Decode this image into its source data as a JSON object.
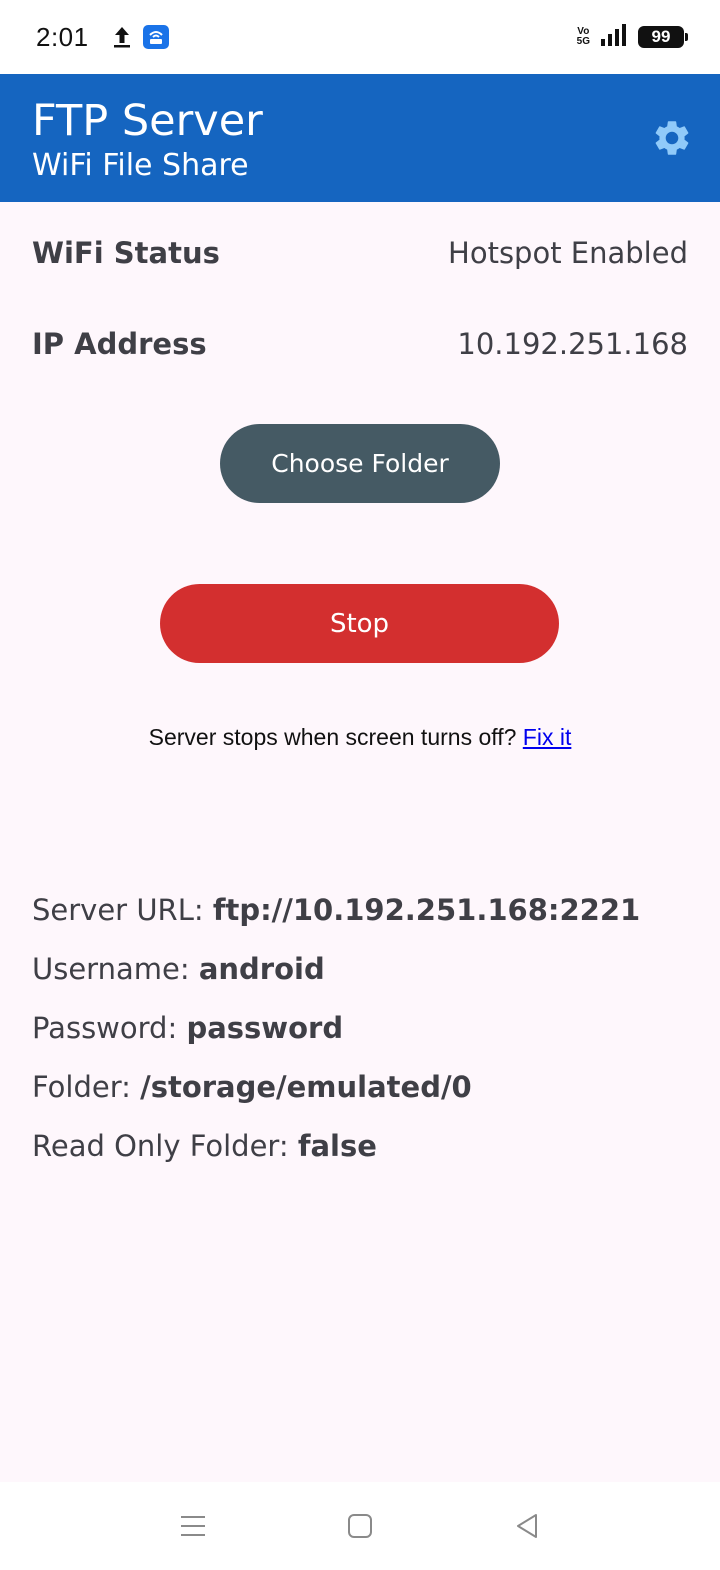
{
  "status_bar": {
    "time": "2:01",
    "battery": "99",
    "volte_top": "Vo",
    "volte_bottom": "5G",
    "icons": [
      "upload-icon",
      "app-notification-icon",
      "volte-icon",
      "signal-icon",
      "battery-icon"
    ]
  },
  "app_bar": {
    "title": "FTP Server",
    "subtitle": "WiFi File Share",
    "settings_icon": "gear-icon"
  },
  "info": {
    "wifi_status_label": "WiFi Status",
    "wifi_status_value": "Hotspot Enabled",
    "ip_label": "IP Address",
    "ip_value": "10.192.251.168"
  },
  "buttons": {
    "choose_folder": "Choose Folder",
    "stop": "Stop"
  },
  "hint": {
    "text": "Server stops when screen turns off?",
    "link": "Fix it"
  },
  "details": {
    "server_url_label": "Server URL:",
    "server_url_value": "ftp://10.192.251.168:2221",
    "username_label": "Username:",
    "username_value": "android",
    "password_label": "Password:",
    "password_value": "password",
    "folder_label": "Folder:",
    "folder_value": "/storage/emulated/0",
    "readonly_label": "Read Only Folder:",
    "readonly_value": "false"
  },
  "nav_bar": {
    "icons": [
      "menu-icon",
      "home-icon",
      "back-icon"
    ]
  },
  "colors": {
    "app_bar": "#1565c0",
    "choose_folder_button": "#455a64",
    "stop_button": "#d32f2f",
    "link": "#0000ee",
    "background": "#fef7fc"
  }
}
